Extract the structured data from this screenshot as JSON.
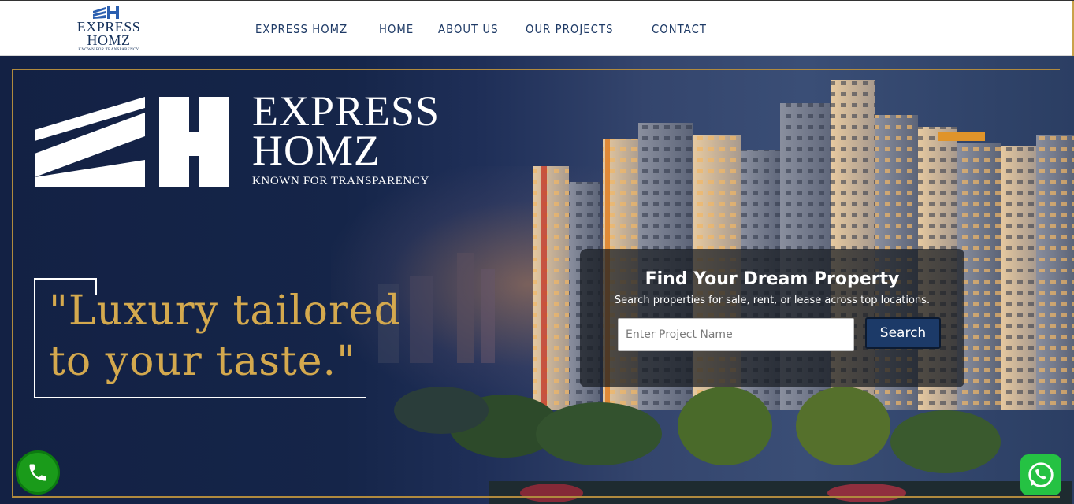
{
  "header": {
    "logo": {
      "line1": "EXPRESS",
      "line2": "HOMZ",
      "tagline": "KNOWN FOR TRANSPARENCY"
    },
    "nav": [
      {
        "label": "EXPRESS HOMZ"
      },
      {
        "label": "HOME"
      },
      {
        "label": "ABOUT US"
      },
      {
        "label": "OUR PROJECTS"
      },
      {
        "label": "CONTACT"
      }
    ]
  },
  "hero": {
    "brand": {
      "line1": "EXPRESS",
      "line2": "HOMZ",
      "tagline": "KNOWN FOR TRANSPARENCY"
    },
    "quote": {
      "line1": "\"Luxury tailored",
      "line2": "to your taste.\""
    },
    "search": {
      "title": "Find Your Dream Property",
      "subtitle": "Search properties for sale, rent, or lease across top locations.",
      "placeholder": "Enter Project Name",
      "value": "",
      "button_label": "Search"
    }
  },
  "floating": {
    "call_icon": "phone-icon",
    "whatsapp_icon": "whatsapp-icon"
  },
  "colors": {
    "navy": "#14305a",
    "gold": "#d4a94e",
    "search_button": "#1c3a68",
    "call_green": "#1a9b1a",
    "whatsapp_green": "#25c243"
  }
}
